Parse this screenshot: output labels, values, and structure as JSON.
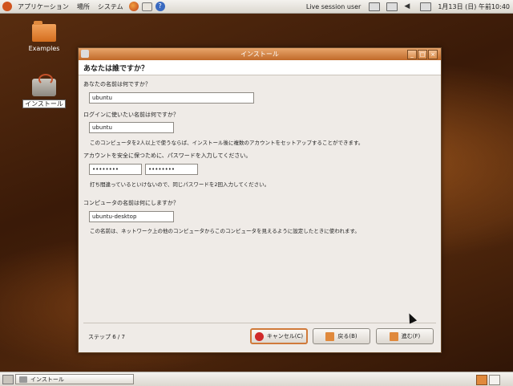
{
  "top_panel": {
    "menus": [
      "アプリケーション",
      "場所",
      "システム"
    ],
    "session": "Live session user",
    "date": "1月13日 (日) 午前10:40"
  },
  "desktop": {
    "examples_label": "Examples",
    "install_label": "インストール"
  },
  "window": {
    "title": "インストール",
    "page_title": "あなたは誰ですか？",
    "name_label": "あなたの名前は何ですか？",
    "name_value": "ubuntu",
    "login_label": "ログインに使いたい名前は何ですか？",
    "login_value": "ubuntu",
    "login_note": "このコンピュータを2人以上で使うならば、インストール後に複数のアカウントをセットアップすることができます。",
    "password_label": "アカウントを安全に保つために、パスワードを入力してください。",
    "password_value": "••••••••",
    "password_confirm_value": "••••••••",
    "password_note": "打ち間違っているといけないので、同じパスワードを2回入力してください。",
    "computer_label": "コンピュータの名前は何にしますか？",
    "computer_value": "ubuntu-desktop",
    "computer_note": "この名前は、ネットワーク上の他のコンピュータからこのコンピュータを見えるように設定したときに使われます。",
    "step_text": "ステップ 6 / 7",
    "cancel_label": "キャンセル(C)",
    "back_label": "戻る(B)",
    "forward_label": "進む(F)"
  },
  "bottom_panel": {
    "task_label": "インストール"
  },
  "colors": {
    "accent": "#d07a3a",
    "titlebar": "#c06a2a"
  }
}
